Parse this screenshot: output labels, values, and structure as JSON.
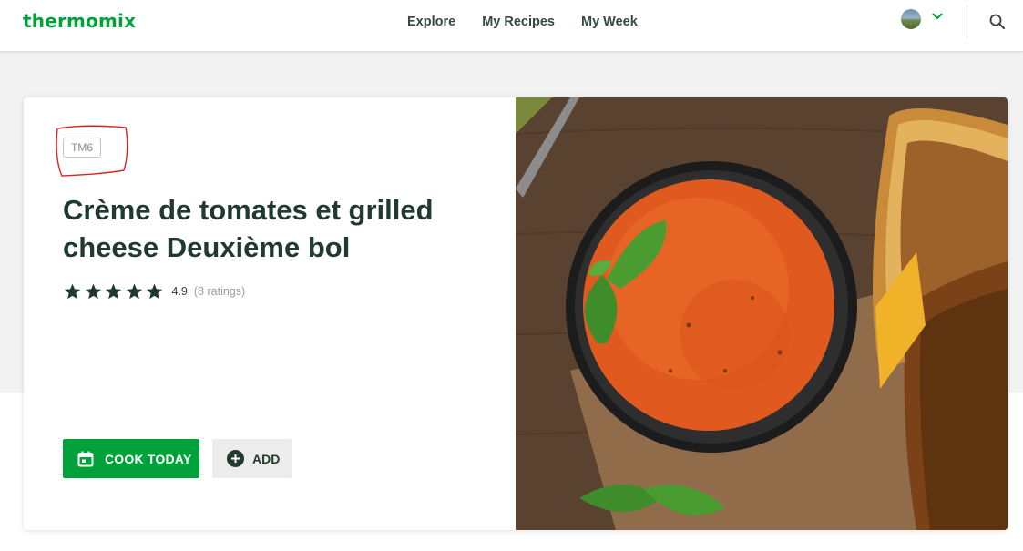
{
  "brand": {
    "logo_text": "thermomix",
    "color": "#00a13a"
  },
  "nav": {
    "items": [
      "Explore",
      "My Recipes",
      "My Week"
    ]
  },
  "header": {
    "avatar_icon": "user-avatar",
    "menu_icon": "chevron-down-icon",
    "search_icon": "search-icon"
  },
  "recipe": {
    "badge": "TM6",
    "title": "Crème de tomates et grilled cheese Deuxième bol",
    "rating": {
      "stars": 5,
      "value": "4.9",
      "count": "(8 ratings)"
    },
    "image": "tomato-soup-with-grilled-cheese"
  },
  "actions": {
    "cook_today": {
      "label": "COOK TODAY",
      "icon": "calendar-icon"
    },
    "add": {
      "label": "ADD",
      "icon": "plus-circle-icon"
    }
  },
  "colors": {
    "accent": "#00a13a",
    "title": "#213a2e",
    "annotation": "#e0201e"
  }
}
